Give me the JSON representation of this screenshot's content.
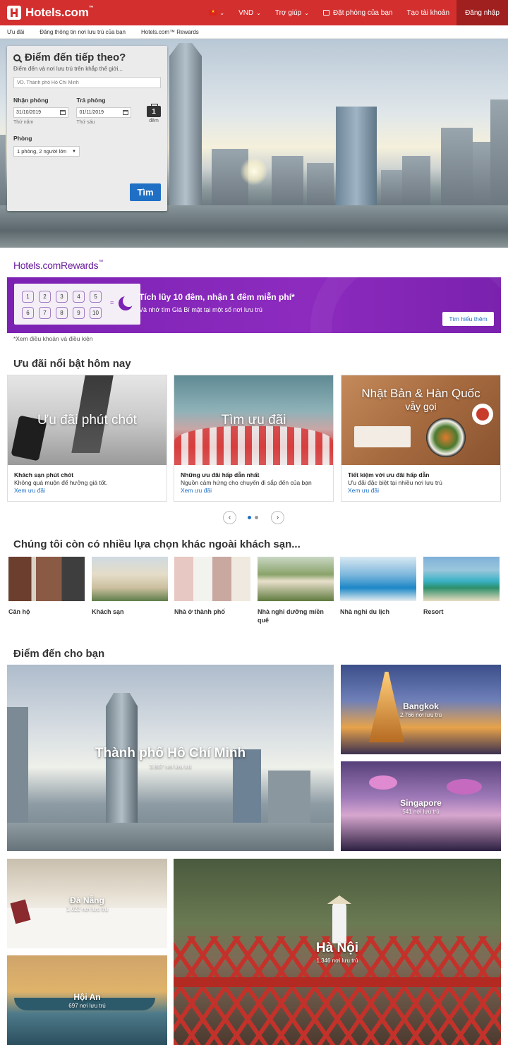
{
  "header": {
    "logo_text": "Hotels.com",
    "logo_tm": "™",
    "currency": "VND",
    "help": "Trợ giúp",
    "bookings": "Đặt phòng của bạn",
    "create_account": "Tạo tài khoản",
    "sign_in": "Đăng nhập",
    "brand_color": "#d32f2f"
  },
  "subnav": {
    "items": [
      "Ưu đãi",
      "Đăng thông tin nơi lưu trú của bạn",
      "Hotels.com™ Rewards"
    ]
  },
  "search": {
    "title": "Điểm đến tiếp theo?",
    "subtitle": "Điểm đến và nơi lưu trú trên khắp thế giới...",
    "destination_placeholder": "VD. Thành phố Hồ Chí Minh",
    "checkin_label": "Nhận phòng",
    "checkin_value": "31/10/2019",
    "checkin_day": "Thứ năm",
    "checkout_label": "Trả phòng",
    "checkout_value": "01/11/2019",
    "checkout_day": "Thứ sáu",
    "nights": "1",
    "nights_label": "đêm",
    "rooms_label": "Phòng",
    "rooms_value": "1 phòng, 2 người lớn",
    "button": "Tìm"
  },
  "rewards": {
    "logo": "Hotels.com",
    "logo_suffix": "Rewards",
    "logo_tm": "™",
    "stamps": [
      "1",
      "2",
      "3",
      "4",
      "5",
      "6",
      "7",
      "8",
      "9",
      "10"
    ],
    "equals": "=",
    "title": "Tích lũy 10 đêm, nhận 1 đêm miễn phí*",
    "subtitle": "Và nhớ tìm Giá Bí mật tại một số nơi lưu trú",
    "button": "Tìm hiểu thêm",
    "terms": "*Xem điều khoản và điều kiện"
  },
  "deals": {
    "title": "Ưu đãi nổi bật hôm nay",
    "cards": [
      {
        "overlay": "Ưu đãi phút chót",
        "overlay_sub": "",
        "title": "Khách sạn phút chót",
        "desc": "Không quá muộn để hưởng giá tốt.",
        "link": "Xem ưu đãi"
      },
      {
        "overlay": "Tìm ưu đãi",
        "overlay_sub": "",
        "title": "Những ưu đãi hấp dẫn nhất",
        "desc": "Nguồn cảm hứng cho chuyến đi sắp đến của bạn",
        "link": "Xem ưu đãi"
      },
      {
        "overlay": "Nhật Bản & Hàn Quốc",
        "overlay_sub": "vẫy gọi",
        "title": "Tiết kiệm với ưu đãi hấp dẫn",
        "desc": "Ưu đãi đặc biệt tại nhiều nơi lưu trú",
        "link": "Xem ưu đãi"
      }
    ],
    "prev": "‹",
    "next": "›"
  },
  "property_types": {
    "title": "Chúng tôi còn có nhiều lựa chọn khác ngoài khách sạn...",
    "items": [
      "Căn hộ",
      "Khách sạn",
      "Nhà ở thành phố",
      "Nhà nghỉ dưỡng miền quê",
      "Nhà nghỉ du lịch",
      "Resort"
    ]
  },
  "destinations": {
    "title": "Điểm đến cho bạn",
    "items": [
      {
        "name": "Thành phố Hồ Chí Minh",
        "count": "3.867 nơi lưu trú"
      },
      {
        "name": "Bangkok",
        "count": "2.766 nơi lưu trú"
      },
      {
        "name": "Singapore",
        "count": "541 nơi lưu trú"
      },
      {
        "name": "Đà Nẵng",
        "count": "1.022 nơi lưu trú"
      },
      {
        "name": "Hà Nội",
        "count": "1.346 nơi lưu trú"
      },
      {
        "name": "Hội An",
        "count": "697 nơi lưu trú"
      }
    ]
  }
}
